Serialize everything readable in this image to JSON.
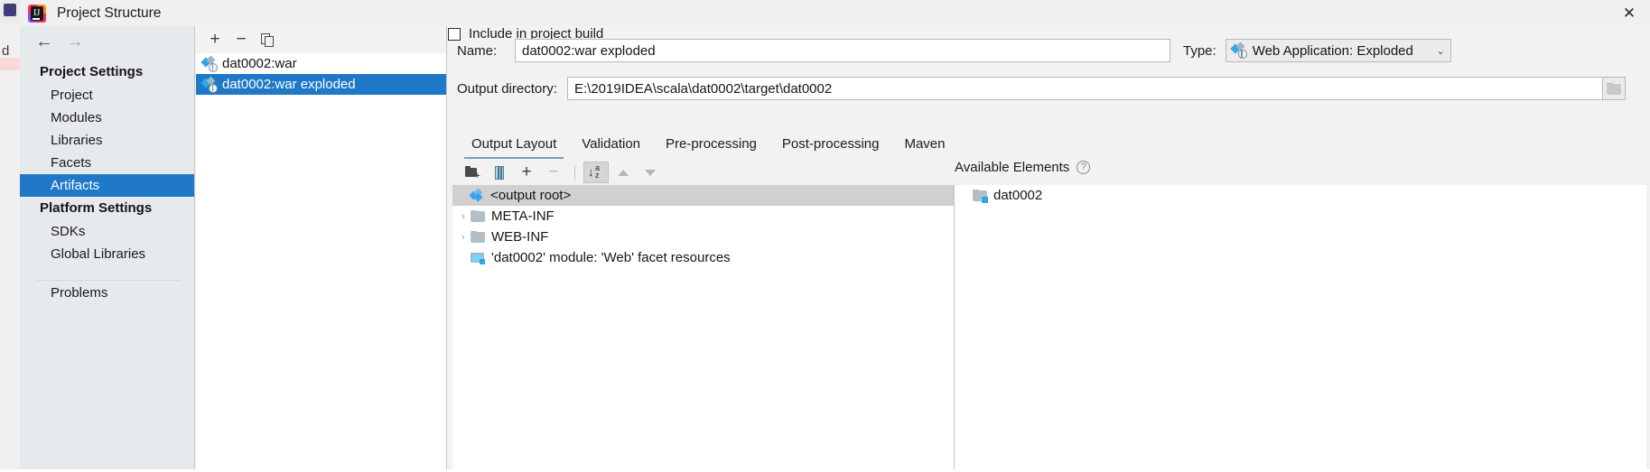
{
  "window": {
    "title": "Project Structure",
    "logo_icon": "intellij-idea-logo-icon",
    "close_icon": "close-icon",
    "close_label": "✕"
  },
  "sidebar": {
    "back_icon": "arrow-left-icon",
    "back_label": "←",
    "forward_icon": "arrow-right-icon",
    "forward_label": "→",
    "groups": [
      {
        "label": "Project Settings",
        "items": [
          {
            "label": "Project",
            "selected": false
          },
          {
            "label": "Modules",
            "selected": false
          },
          {
            "label": "Libraries",
            "selected": false
          },
          {
            "label": "Facets",
            "selected": false
          },
          {
            "label": "Artifacts",
            "selected": true
          }
        ]
      },
      {
        "label": "Platform Settings",
        "items": [
          {
            "label": "SDKs",
            "selected": false
          },
          {
            "label": "Global Libraries",
            "selected": false
          }
        ]
      }
    ],
    "problems_label": "Problems"
  },
  "artifacts_panel": {
    "toolbar": [
      {
        "name": "add-artifact-button",
        "icon": "plus-icon",
        "label": "+"
      },
      {
        "name": "remove-artifact-button",
        "icon": "minus-icon",
        "label": "−"
      },
      {
        "name": "copy-artifact-button",
        "icon": "copy-icon",
        "label": ""
      }
    ],
    "items": [
      {
        "label": "dat0002:war",
        "icon": "artifact-icon",
        "selected": false
      },
      {
        "label": "dat0002:war exploded",
        "icon": "artifact-icon",
        "selected": true
      }
    ]
  },
  "details": {
    "name_label": "Name:",
    "name_value": "dat0002:war exploded",
    "type_label": "Type:",
    "type_value": "Web Application: Exploded",
    "type_icon": "artifact-icon",
    "type_caret": "⌄",
    "output_dir_label": "Output directory:",
    "output_dir_value": "E:\\2019IDEA\\scala\\dat0002\\target\\dat0002",
    "browse_icon": "folder-browse-icon",
    "include_in_build_label": "Include in project build",
    "include_in_build_checked": false
  },
  "tabs": [
    {
      "label": "Output Layout",
      "active": true
    },
    {
      "label": "Validation",
      "active": false
    },
    {
      "label": "Pre-processing",
      "active": false
    },
    {
      "label": "Post-processing",
      "active": false
    },
    {
      "label": "Maven",
      "active": false
    }
  ],
  "layout_toolbar": [
    {
      "name": "add-directory-button",
      "icon": "folder-plus-icon",
      "disabled": false,
      "pressed": false
    },
    {
      "name": "add-archive-button",
      "icon": "archive-icon",
      "disabled": false,
      "pressed": false
    },
    {
      "name": "add-element-button",
      "icon": "plus-dropdown-icon",
      "disabled": false,
      "pressed": false,
      "label": "+"
    },
    {
      "name": "remove-element-button",
      "icon": "minus-icon",
      "disabled": true,
      "pressed": false,
      "label": "−"
    },
    {
      "name": "sort-button",
      "icon": "sort-az-icon",
      "disabled": false,
      "pressed": true
    },
    {
      "name": "move-up-button",
      "icon": "triangle-up-icon",
      "disabled": true,
      "pressed": false
    },
    {
      "name": "move-down-button",
      "icon": "triangle-down-icon",
      "disabled": true,
      "pressed": false
    }
  ],
  "output_layout_tree": {
    "rows": [
      {
        "label": "<output root>",
        "icon": "output-root-icon",
        "indent": 0,
        "expander": "",
        "selected": true
      },
      {
        "label": "META-INF",
        "icon": "folder-icon",
        "indent": 1,
        "expander": "›",
        "selected": false
      },
      {
        "label": "WEB-INF",
        "icon": "folder-icon",
        "indent": 1,
        "expander": "›",
        "selected": false
      },
      {
        "label": "'dat0002' module: 'Web' facet resources",
        "icon": "web-resources-icon",
        "indent": 1,
        "expander": "",
        "selected": false
      }
    ]
  },
  "available_elements": {
    "header": "Available Elements",
    "help_icon": "help-icon",
    "help_label": "?",
    "rows": [
      {
        "label": "dat0002",
        "icon": "module-folder-icon"
      }
    ]
  },
  "colors": {
    "selection_blue": "#1f78c8",
    "row_selection_gray": "#d0d0d0",
    "accent_cyan": "#35a4e8",
    "dialog_bg": "#f2f2f2",
    "sidebar_bg": "#e6eaed",
    "tab_underline": "#7f9bb6"
  }
}
